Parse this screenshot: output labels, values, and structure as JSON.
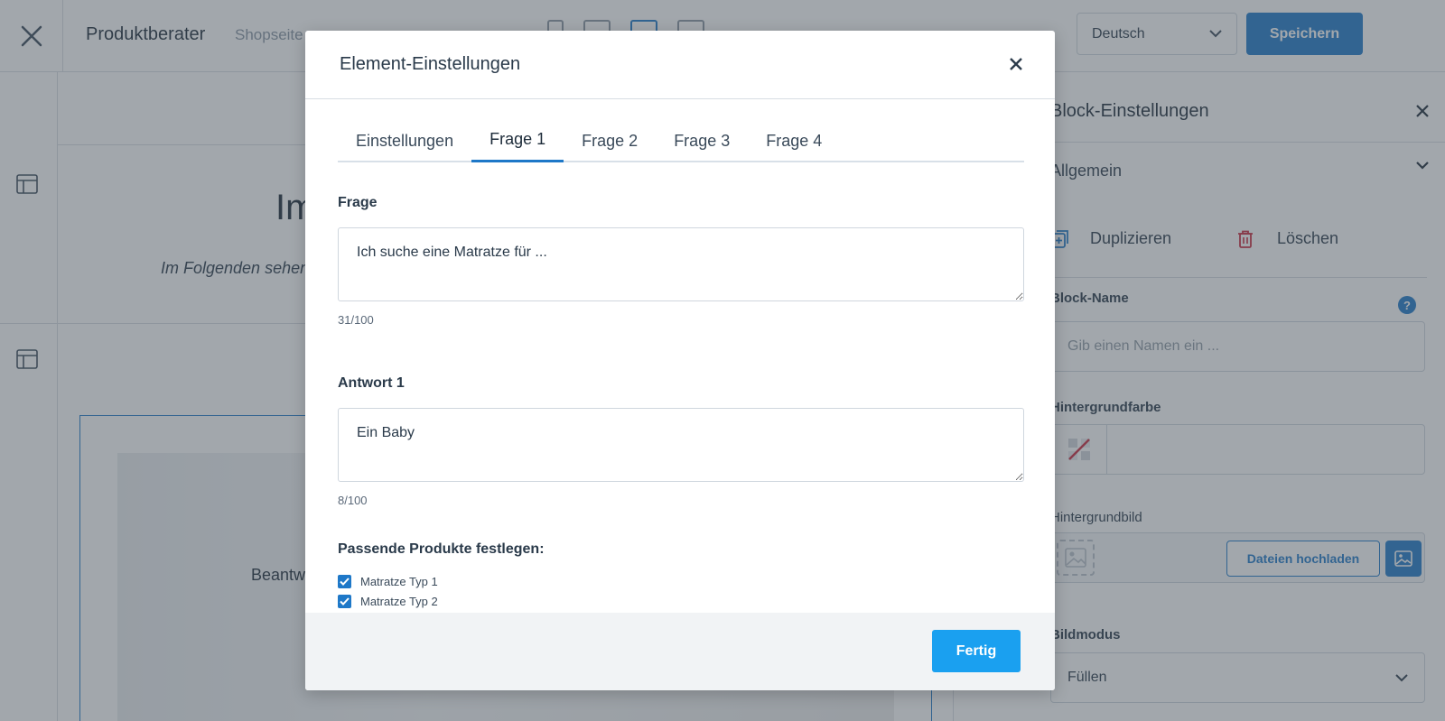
{
  "topbar": {
    "title": "Produktberater",
    "subtitle": "Shopseite",
    "language": "Deutsch",
    "save_label": "Speichern"
  },
  "canvas": {
    "heading": "Im",
    "italic_text": "Im Folgenden sehen",
    "block_text": "Beantw"
  },
  "right_panel": {
    "title": "Block-Einstellungen",
    "general_label": "Allgemein",
    "duplicate_label": "Duplizieren",
    "delete_label": "Löschen",
    "block_name_label": "Block-Name",
    "block_name_placeholder": "Gib einen Namen ein ...",
    "help_glyph": "?",
    "bg_color_label": "Hintergrundfarbe",
    "bg_image_label": "Hintergrundbild",
    "upload_label": "Dateien hochladen",
    "image_mode_label": "Bildmodus",
    "image_mode_value": "Füllen"
  },
  "modal": {
    "title": "Element-Einstellungen",
    "tabs": [
      {
        "label": "Einstellungen",
        "active": false
      },
      {
        "label": "Frage 1",
        "active": true
      },
      {
        "label": "Frage 2",
        "active": false
      },
      {
        "label": "Frage 3",
        "active": false
      },
      {
        "label": "Frage 4",
        "active": false
      }
    ],
    "question_label": "Frage",
    "question_value": "Ich suche eine Matratze für ...",
    "question_counter": "31/100",
    "answer_label": "Antwort 1",
    "answer_value": "Ein Baby",
    "answer_counter": "8/100",
    "products_label": "Passende Produkte festlegen:",
    "products": [
      {
        "label": "Matratze Typ 1",
        "checked": true
      },
      {
        "label": "Matratze Typ 2",
        "checked": true
      }
    ],
    "done_label": "Fertig"
  },
  "colors": {
    "accent": "#1e78c8",
    "done_button": "#1aa0f0",
    "delete_icon": "#c8283c"
  }
}
